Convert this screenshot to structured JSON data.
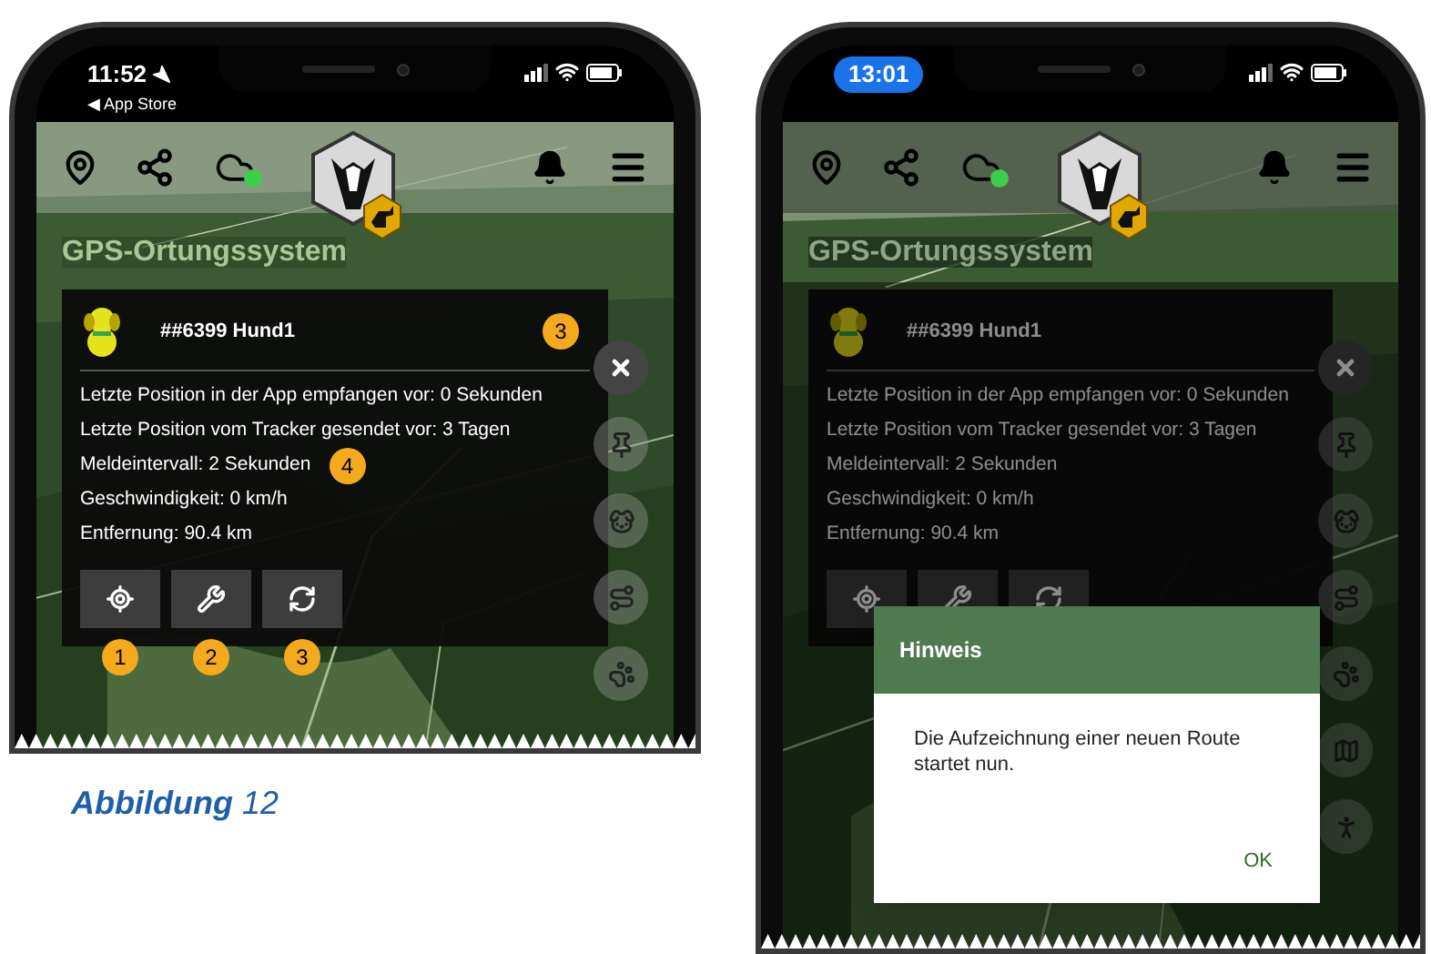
{
  "phones": [
    {
      "status": {
        "time": "11:52",
        "time_highlighted": false,
        "back_link": "◀ App Store"
      },
      "app_title": "GPS-Ortungssystem",
      "dimmed": false,
      "tracker": {
        "name": "##6399 Hund1",
        "close_callout": "3",
        "lines": [
          {
            "text": "Letzte Position in der App empfangen vor: 0 Sekunden"
          },
          {
            "text": "Letzte Position vom Tracker gesendet vor: 3 Tagen"
          },
          {
            "text": "Meldeintervall: 2 Sekunden",
            "callout": "4"
          },
          {
            "text": "Geschwindigkeit: 0 km/h"
          },
          {
            "text": "Entfernung: 90.4 km"
          }
        ]
      },
      "actions": [
        {
          "kind": "locate",
          "callout": "1"
        },
        {
          "kind": "settings",
          "callout": "2"
        },
        {
          "kind": "refresh",
          "callout": "3"
        }
      ],
      "fabs": [
        {
          "kind": "pin"
        },
        {
          "kind": "dog"
        },
        {
          "kind": "route"
        },
        {
          "kind": "paw"
        }
      ]
    },
    {
      "status": {
        "time": "13:01",
        "time_highlighted": true
      },
      "app_title": "GPS-Ortungssystem",
      "dimmed": true,
      "tracker": {
        "name": "##6399 Hund1",
        "lines": [
          {
            "text": "Letzte Position in der App empfangen vor: 0 Sekunden"
          },
          {
            "text": "Letzte Position vom Tracker gesendet vor: 3 Tagen"
          },
          {
            "text": "Meldeintervall: 2 Sekunden"
          },
          {
            "text": "Geschwindigkeit: 0 km/h"
          },
          {
            "text": "Entfernung: 90.4 km"
          }
        ]
      },
      "actions": [
        {
          "kind": "locate"
        },
        {
          "kind": "settings"
        },
        {
          "kind": "refresh"
        }
      ],
      "fabs": [
        {
          "kind": "pin"
        },
        {
          "kind": "dog"
        },
        {
          "kind": "route"
        },
        {
          "kind": "paw"
        },
        {
          "kind": "map"
        },
        {
          "kind": "person"
        }
      ],
      "dialog": {
        "title": "Hinweis",
        "message": "Die Aufzeichnung einer neuen Route startet nun.",
        "button": "OK"
      }
    }
  ],
  "caption": "**Abbildung** 12"
}
